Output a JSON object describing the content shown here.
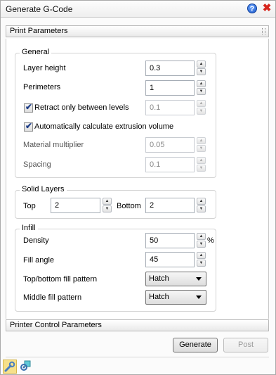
{
  "window": {
    "title": "Generate G-Code",
    "help_glyph": "?",
    "close_glyph": "✖"
  },
  "sections": {
    "print_parameters": "Print Parameters",
    "printer_control_parameters": "Printer Control Parameters"
  },
  "general": {
    "title": "General",
    "layer_height": {
      "label": "Layer height",
      "value": "0.3"
    },
    "perimeters": {
      "label": "Perimeters",
      "value": "1"
    },
    "retract": {
      "label": "Retract only between levels",
      "checked": true,
      "value": "0.1"
    },
    "auto_extrusion": {
      "label": "Automatically calculate extrusion volume",
      "checked": true
    },
    "material_multiplier": {
      "label": "Material multiplier",
      "value": "0.05"
    },
    "spacing": {
      "label": "Spacing",
      "value": "0.1"
    }
  },
  "solid_layers": {
    "title": "Solid Layers",
    "top": {
      "label": "Top",
      "value": "2"
    },
    "bottom": {
      "label": "Bottom",
      "value": "2"
    }
  },
  "infill": {
    "title": "Infill",
    "density": {
      "label": "Density",
      "value": "50",
      "unit": "%"
    },
    "fill_angle": {
      "label": "Fill angle",
      "value": "45"
    },
    "top_bottom_pattern": {
      "label": "Top/bottom fill pattern",
      "value": "Hatch"
    },
    "middle_pattern": {
      "label": "Middle fill pattern",
      "value": "Hatch"
    }
  },
  "buttons": {
    "generate": "Generate",
    "post": "Post"
  },
  "spin_glyphs": {
    "up": "▲",
    "down": "▼"
  },
  "check_glyph": "✔",
  "icons": [
    "wrench-icon",
    "gear-icon"
  ]
}
